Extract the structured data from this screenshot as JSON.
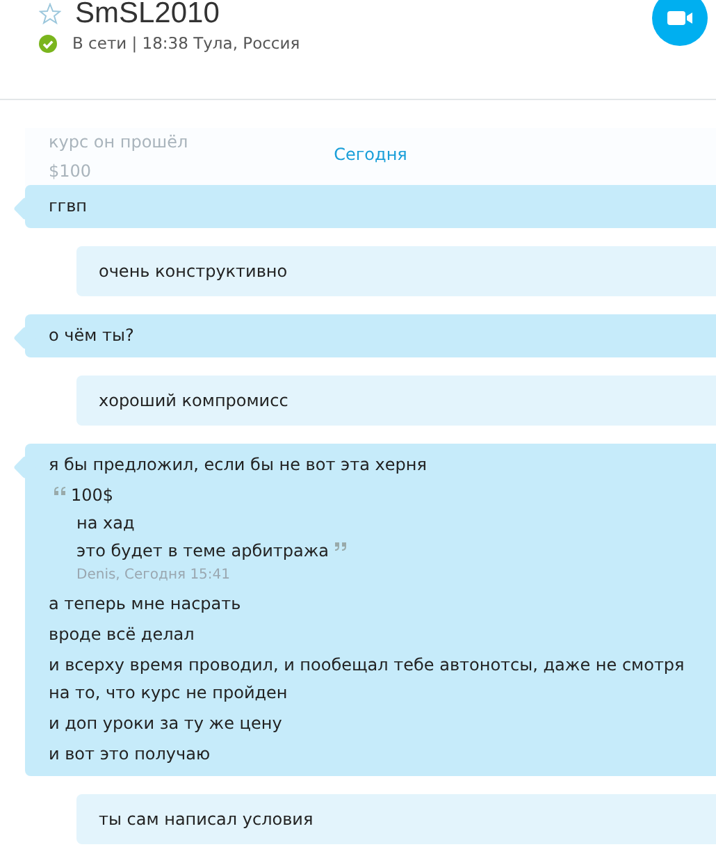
{
  "contact": {
    "name": "SmSL2010",
    "favorite": false,
    "online": true,
    "status": "В сети | 18:38 Тула, Россия"
  },
  "history": {
    "lines": [
      "курс он прошёл",
      "$100"
    ],
    "date_label": "Сегодня"
  },
  "messages": [
    {
      "kind": "incoming",
      "lines": [
        "ггвп"
      ]
    },
    {
      "kind": "outgoing",
      "lines": [
        "очень конструктивно"
      ]
    },
    {
      "kind": "incoming",
      "lines": [
        "о чём ты?"
      ]
    },
    {
      "kind": "outgoing",
      "lines": [
        "хороший компромисс"
      ]
    },
    {
      "kind": "incoming",
      "lines": [
        "я бы предложил, если бы не вот эта херня"
      ],
      "quote": {
        "lines": [
          "100$",
          "на хад",
          "это будет в теме арбитража"
        ],
        "author": "Denis, Сегодня 15:41"
      },
      "after": [
        "а теперь мне насрать",
        "вроде всё делал",
        "и всерху время проводил, и пообещал тебе автонотсы, даже не смотря на то, что курс не пройден",
        "и доп уроки за ту же цену",
        "и вот это получаю"
      ]
    },
    {
      "kind": "outgoing",
      "lines": [
        "ты сам написал условия"
      ]
    }
  ]
}
